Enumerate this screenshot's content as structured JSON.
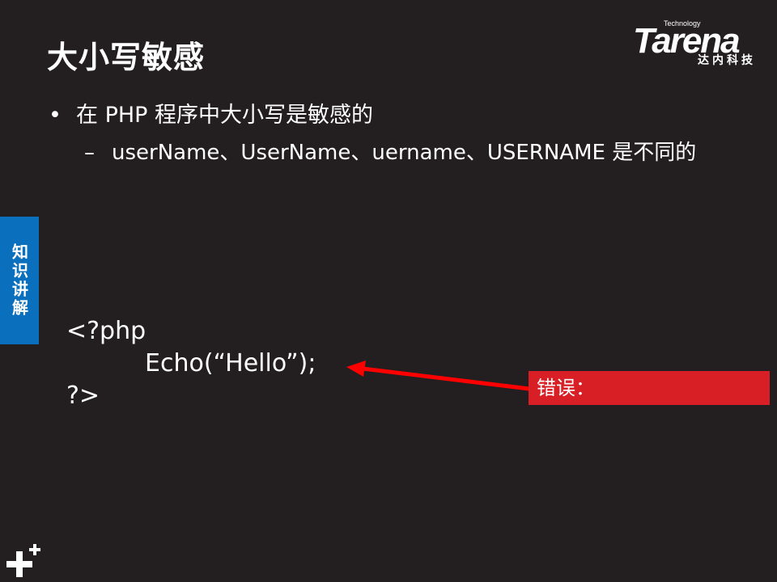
{
  "slide": {
    "title": "大小写敏感",
    "bullet": "在 PHP 程序中大小写是敏感的",
    "sub_bullet": "userName、UserName、uername、USERNAME 是不同的",
    "side_tab": "知识讲解",
    "code": {
      "line1": "<?php",
      "line2": "Echo(“Hello”);",
      "line3": "?>"
    },
    "error_label": "错误："
  },
  "logo": {
    "tech": "Technology",
    "word": "Tarena",
    "cn": "达内科技"
  },
  "colors": {
    "background": "#231f20",
    "side_tab": "#0a6fbd",
    "error": "#d81f26",
    "arrow": "#ff0000"
  },
  "icons": [
    "bullet-dot-icon",
    "dash-icon",
    "arrow-icon",
    "plus-logo-icon"
  ]
}
